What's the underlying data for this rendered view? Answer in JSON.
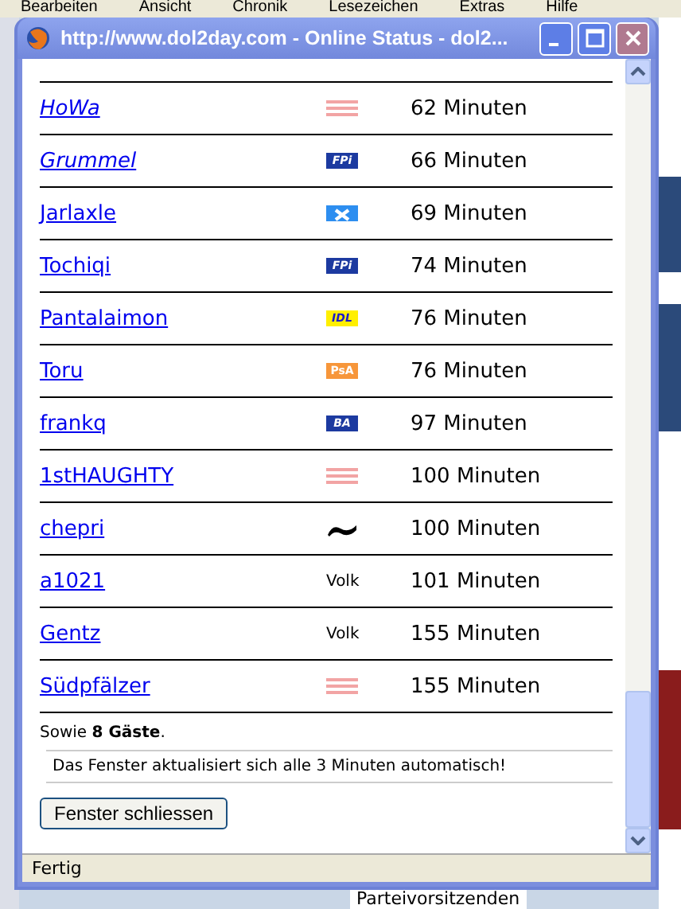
{
  "background": {
    "menu": [
      "Bearbeiten",
      "Ansicht",
      "Chronik",
      "Lesezeichen",
      "Extras",
      "Hilfe"
    ],
    "footer_text": "Parteivorsitzenden"
  },
  "window": {
    "title": "http://www.dol2day.com - Online Status - dol2..."
  },
  "users": [
    {
      "name": "HoWa",
      "visited": true,
      "party": {
        "kind": "stripes"
      },
      "time": "62 Minuten"
    },
    {
      "name": "Grummel",
      "visited": true,
      "party": {
        "kind": "badge",
        "label": "FPi"
      },
      "time": "66 Minuten"
    },
    {
      "name": "Jarlaxle",
      "visited": false,
      "party": {
        "kind": "cross"
      },
      "time": "69 Minuten"
    },
    {
      "name": "Tochiqi",
      "visited": false,
      "party": {
        "kind": "badge",
        "label": "FPi"
      },
      "time": "74 Minuten"
    },
    {
      "name": "Pantalaimon",
      "visited": false,
      "party": {
        "kind": "yellow",
        "label": "IDL"
      },
      "time": "76 Minuten"
    },
    {
      "name": "Toru",
      "visited": false,
      "party": {
        "kind": "orange",
        "label": "PsA"
      },
      "time": "76 Minuten"
    },
    {
      "name": "frankq",
      "visited": false,
      "party": {
        "kind": "badge",
        "label": "BA"
      },
      "time": "97 Minuten"
    },
    {
      "name": "1stHAUGHTY",
      "visited": false,
      "party": {
        "kind": "stripes"
      },
      "time": "100 Minuten"
    },
    {
      "name": "chepri",
      "visited": false,
      "party": {
        "kind": "wave"
      },
      "time": "100 Minuten"
    },
    {
      "name": "a1021",
      "visited": false,
      "party": {
        "kind": "text",
        "label": "Volk"
      },
      "time": "101 Minuten"
    },
    {
      "name": "Gentz",
      "visited": false,
      "party": {
        "kind": "text",
        "label": "Volk"
      },
      "time": "155 Minuten"
    },
    {
      "name": "Südpfälzer",
      "visited": false,
      "party": {
        "kind": "stripes"
      },
      "time": "155 Minuten"
    }
  ],
  "guests": "Sowie **8 Gäste**.",
  "notice": "Das Fenster aktualisiert sich alle 3 Minuten automatisch!",
  "close_button": "Fenster schliessen",
  "status_bar": "Fertig"
}
